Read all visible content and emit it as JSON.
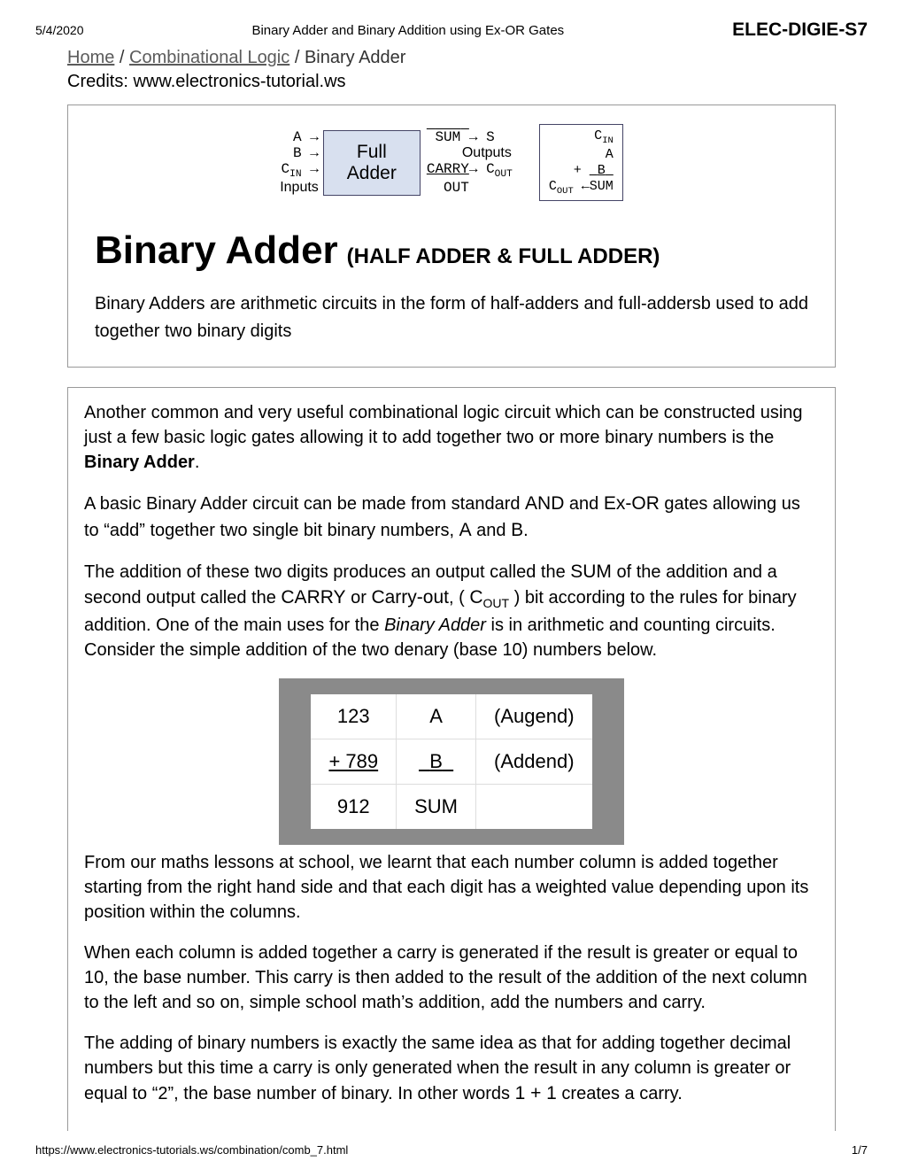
{
  "header": {
    "date": "5/4/2020",
    "center_title": "Binary Adder and Binary Addition using Ex-OR Gates",
    "doc_code": "ELEC-DIGIE-S7"
  },
  "breadcrumb": {
    "home": "Home",
    "sep": " / ",
    "section": "Combinational Logic",
    "current": "Binary Adder"
  },
  "credits": "Credits: www.electronics-tutorial.ws",
  "diagram": {
    "inputs": {
      "a": "A",
      "b": "B",
      "cin": "C",
      "cin_sub": "IN",
      "label": "Inputs"
    },
    "block": {
      "line1": "Full",
      "line2": "Adder"
    },
    "outputs": {
      "sum": "SUM",
      "s": "S",
      "carry": "CARRY",
      "out": "OUT",
      "cout": "C",
      "cout_sub": "OUT",
      "label": "Outputs"
    },
    "notation": {
      "cin": "C",
      "cin_sub": "IN",
      "a": "A",
      "plus": "+",
      "b": "B",
      "cout": "C",
      "cout_sub": "OUT",
      "arrow": "←",
      "sum": "SUM"
    }
  },
  "title": {
    "main": "Binary Adder",
    "sub": "(HALF ADDER & FULL ADDER)"
  },
  "intro": "Binary Adders are arithmetic circuits in the form of half-adders and full-addersb used to add together two binary digits",
  "body": {
    "p1a": "Another common and very useful combinational logic circuit which can be constructed using just a few basic logic gates allowing it to add together two or more binary numbers is the ",
    "p1b": "Binary Adder",
    "p1c": ".",
    "p2a": "A basic Binary Adder circuit can be made from standard ",
    "p2and": "AND",
    "p2b": " and ",
    "p2xor": "Ex-OR",
    "p2c": " gates allowing us to “add” together two single bit binary numbers, ",
    "p2A": "A",
    "p2d": " and ",
    "p2B": "B",
    "p2e": ".",
    "p3a": "The addition of these two digits produces an output called the ",
    "p3sum": "SUM",
    "p3b": " of the addition and a second output called the ",
    "p3carry": "CARRY",
    "p3c": " or ",
    "p3cout": "Carry-out",
    "p3d": ", ( ",
    "p3C": "C",
    "p3Cout_sub": "OUT",
    "p3e": " ) bit according to the rules for binary addition. One of the main uses for the ",
    "p3ba": "Binary Adder",
    "p3f": " is in arithmetic and counting circuits. Consider the simple addition of the two denary (base 10) numbers below.",
    "p4": "From our maths lessons at school, we learnt that each number column is added together starting from the right hand side and that each digit has a weighted value depending upon its position within the columns.",
    "p5": "When each column is added together a carry is generated if the result is greater or equal to 10, the base number. This carry is then added to the result of the addition of the next column to the left and so on, simple school math’s addition, add the numbers and carry.",
    "p6a": "The adding of binary numbers is exactly the same idea as that for adding together decimal numbers but this time a carry is only generated when the result in any column is greater or equal to “2”, the base number of binary. In other words ",
    "p6expr": "1 + 1",
    "p6b": " creates a carry."
  },
  "sum_table": {
    "r1": {
      "num": "123",
      "sym": "A",
      "role": "(Augend)"
    },
    "r2": {
      "num": "+ 789",
      "sym": "B",
      "role": "(Addend)"
    },
    "r3": {
      "num": "912",
      "sym": "SUM",
      "role": ""
    }
  },
  "footer": {
    "url": "https://www.electronics-tutorials.ws/combination/comb_7.html",
    "page": "1/7"
  }
}
